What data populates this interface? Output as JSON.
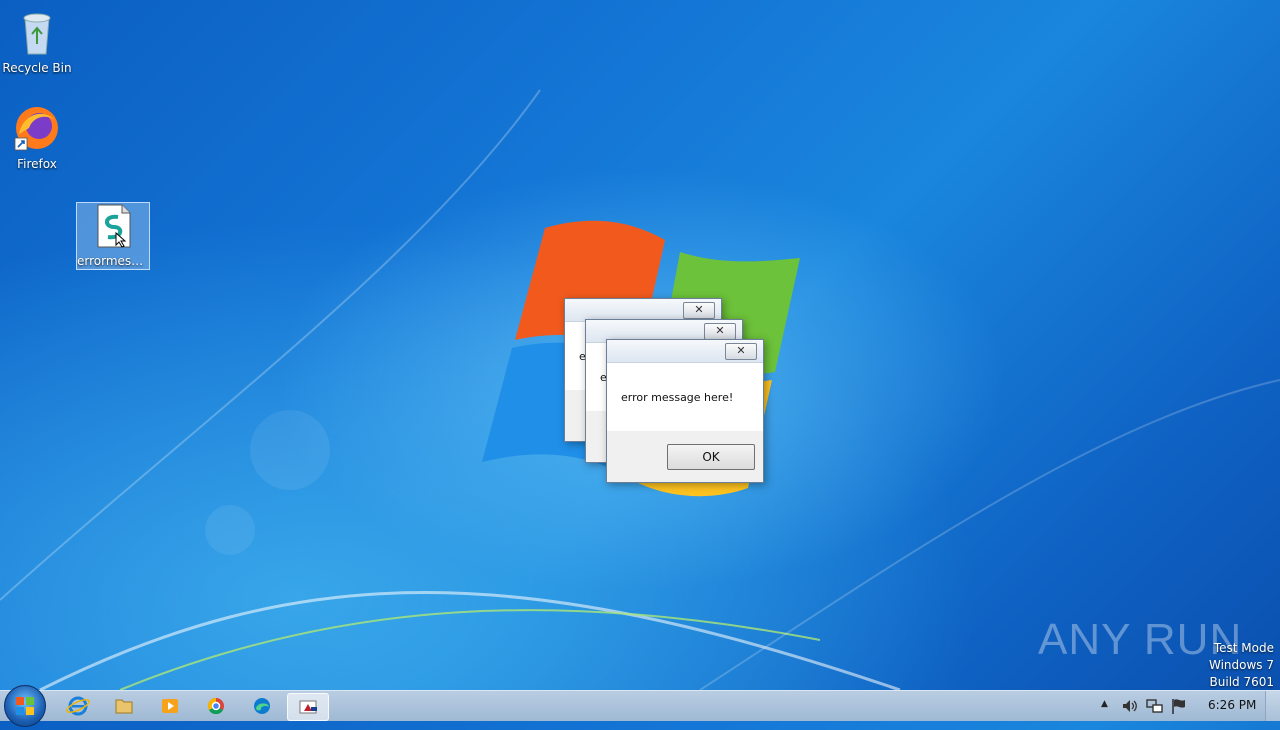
{
  "desktop": {
    "icons": [
      {
        "label": "Recycle Bin"
      },
      {
        "label": "Firefox"
      },
      {
        "label": "errormessa..."
      }
    ]
  },
  "dialogs": {
    "back_partial_text": "e",
    "middle_partial_text": "e",
    "front_message": "error message here!",
    "ok_label": "OK",
    "close_glyph": "✕"
  },
  "watermark": "ANY RUN",
  "system_info": {
    "line1": "Test Mode",
    "line2": "Windows 7",
    "line3": "Build 7601"
  },
  "taskbar": {
    "clock": "6:26 PM",
    "tray_arrow": "▲"
  },
  "colors": {
    "desktop_blue": "#1476d6",
    "taskbar": "#b9cde2",
    "firefox_orange": "#ff7a1a",
    "firefox_purple": "#7b3cc8"
  }
}
